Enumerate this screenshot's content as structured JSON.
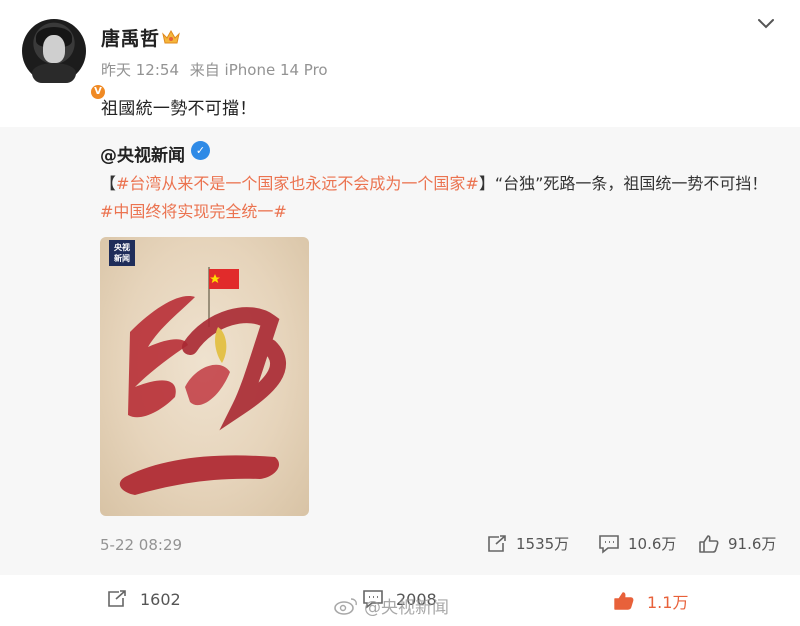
{
  "post": {
    "author": "唐禹哲",
    "time": "昨天 12:54",
    "source": "来自 iPhone 14 Pro",
    "text": "祖國統一勢不可擋！",
    "avatar_badge": "V"
  },
  "repost": {
    "author": "@央视新闻",
    "verified_badge": "✓",
    "text_prefix": "【",
    "topic1": "#台湾从来不是一个国家也永远不会成为一个国家#",
    "text_mid": "】“台独”死路一条，祖国统一势不可挡！",
    "topic2": "#中国终将实现完全统一#",
    "image_logo_line1": "央视",
    "image_logo_line2": "新闻",
    "date": "5-22 08:29",
    "reposts": "1535万",
    "comments": "10.6万",
    "likes": "91.6万"
  },
  "actions": {
    "reposts": "1602",
    "comments": "2008",
    "likes": "1.1万"
  },
  "watermark": "@央视新闻",
  "colors": {
    "topic": "#eb7350",
    "verified_blue": "#2e8ae6",
    "badge_orange": "#f08a24",
    "liked": "#e8613a"
  }
}
